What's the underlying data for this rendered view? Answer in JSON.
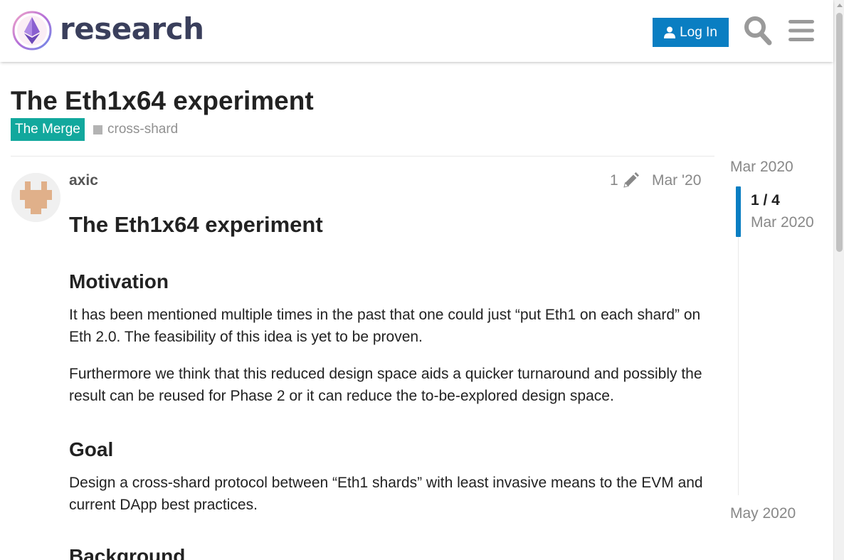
{
  "header": {
    "logo_text": "research",
    "login_label": "Log In"
  },
  "topic": {
    "title": "The Eth1x64 experiment",
    "category": "The Merge",
    "tag": "cross-shard",
    "category_color": "#12a89d"
  },
  "post": {
    "username": "axic",
    "edit_count": "1",
    "date": "Mar '20",
    "heading": "The Eth1x64 experiment",
    "sections": {
      "motivation_heading": "Motivation",
      "motivation_p1": "It has been mentioned multiple times in the past that one could just “put Eth1 on each shard” on Eth 2.0. The feasibility of this idea is yet to be proven.",
      "motivation_p2": "Furthermore we think that this reduced design space aids a quicker turnaround and possibly the result can be reused for Phase 2 or it can reduce the to-be-explored design space.",
      "goal_heading": "Goal",
      "goal_p1": "Design a cross-shard protocol between “Eth1 shards” with least invasive means to the EVM and current DApp best practices.",
      "background_heading": "Background"
    }
  },
  "timeline": {
    "start_label": "Mar 2020",
    "position": "1 / 4",
    "position_date": "Mar 2020",
    "end_label": "May 2020"
  },
  "colors": {
    "accent": "#0a7ec2",
    "category": "#12a89d"
  }
}
